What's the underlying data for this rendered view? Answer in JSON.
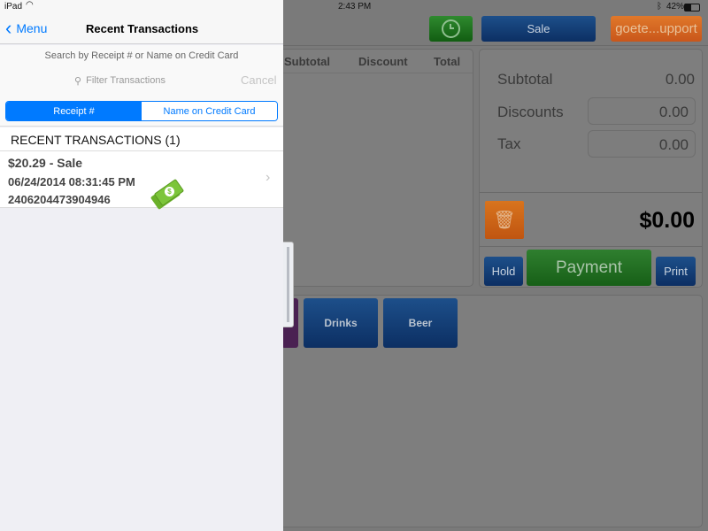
{
  "status_bar": {
    "device": "iPad",
    "time": "2:43 PM",
    "battery": "42%"
  },
  "pos": {
    "toolbar": {
      "clock_icon": "clock-icon",
      "sale_label": "Sale",
      "support_label": "goete...upport"
    },
    "cart_headers": [
      "Subtotal",
      "Discount",
      "Total"
    ],
    "summary": {
      "subtotal_label": "Subtotal",
      "subtotal_value": "0.00",
      "discounts_label": "Discounts",
      "discounts_value": "0.00",
      "tax_label": "Tax",
      "tax_value": "0.00",
      "total": "$0.00"
    },
    "actions": {
      "hold": "Hold",
      "payment": "Payment",
      "print": "Print"
    },
    "categories": [
      "Drinks",
      "Beer"
    ]
  },
  "sidebar": {
    "back_label": "Menu",
    "title": "Recent Transactions",
    "search_hint": "Search by Receipt # or Name on Credit Card",
    "filter_placeholder": "Filter Transactions",
    "cancel_label": "Cancel",
    "segments": [
      "Receipt #",
      "Name on Credit Card"
    ],
    "selected_segment": "Receipt #",
    "section_header": "RECENT TRANSACTIONS (1)",
    "transactions": [
      {
        "title": "$20.29 - Sale",
        "datetime": "06/24/2014 08:31:45 PM",
        "receipt": "2406204473904946",
        "icon": "cash-icon"
      }
    ]
  },
  "colors": {
    "accent": "#007aff",
    "cash_green": "#7cc53a"
  }
}
